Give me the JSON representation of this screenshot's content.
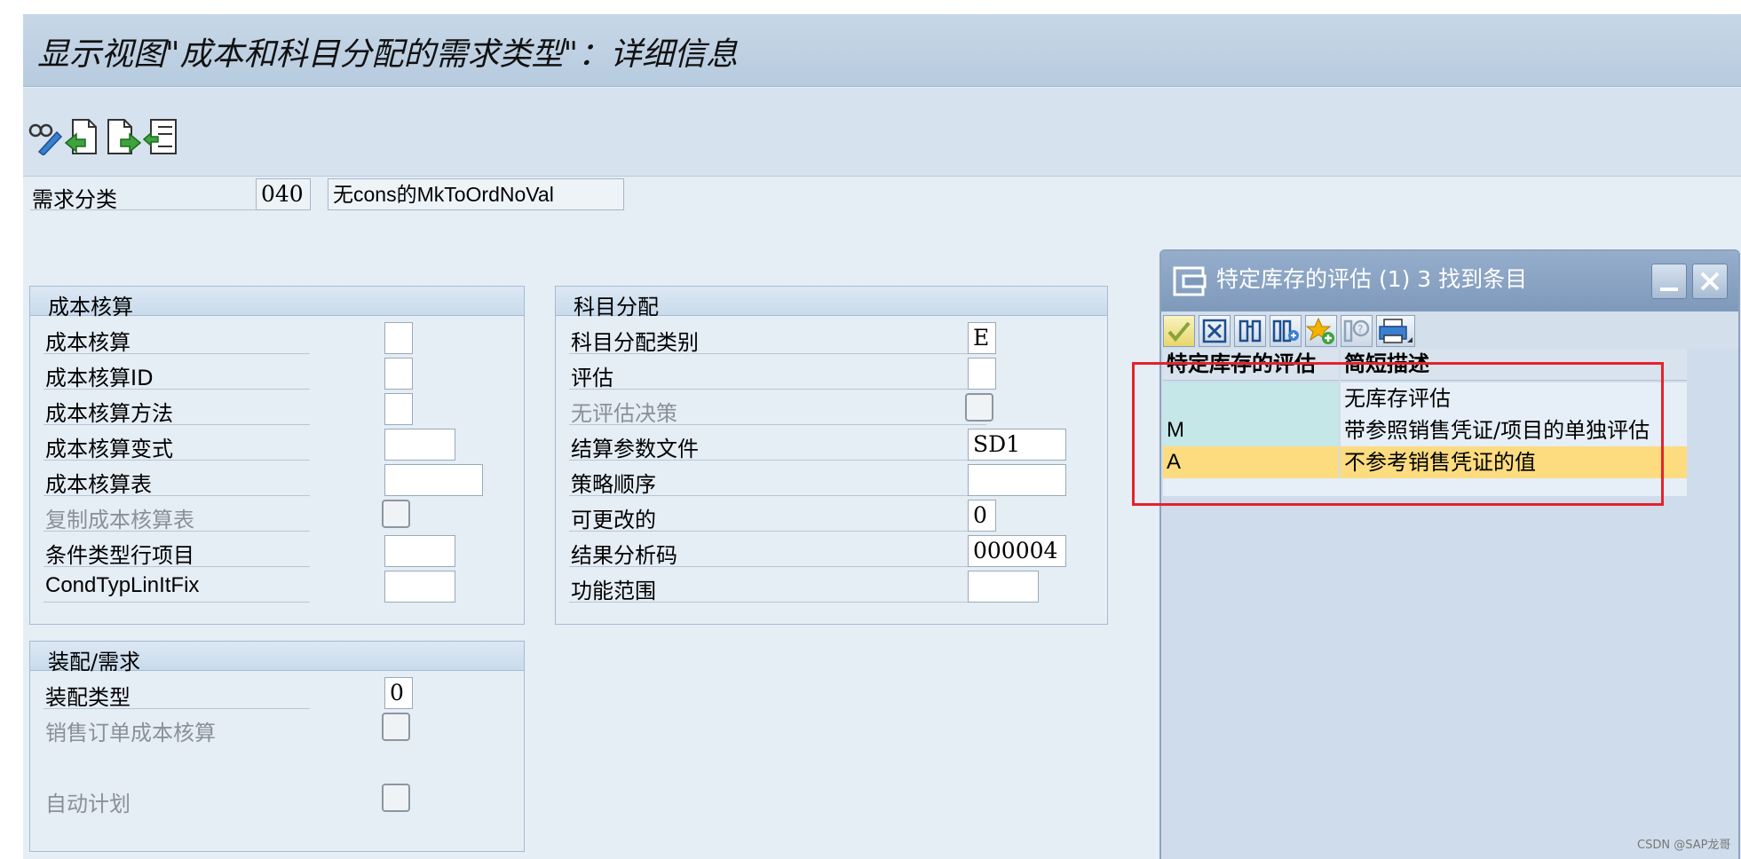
{
  "window": {
    "title": "显示视图\"成本和科目分配的需求类型\"：详细信息"
  },
  "toolbar": {
    "icons": [
      "display-change-icon",
      "previous-entry-icon",
      "next-entry-icon",
      "select-block-icon"
    ]
  },
  "header": {
    "req_class_label": "需求分类",
    "req_class_value": "040",
    "req_class_desc": "无cons的MkToOrdNoVal"
  },
  "costing_group": {
    "title": "成本核算",
    "rows": [
      {
        "label": "成本核算",
        "value": "",
        "disabled": false
      },
      {
        "label": "成本核算ID",
        "value": "",
        "disabled": false
      },
      {
        "label": "成本核算方法",
        "value": "",
        "disabled": false
      },
      {
        "label": "成本核算变式",
        "value": "",
        "disabled": false
      },
      {
        "label": "成本核算表",
        "value": "",
        "disabled": false
      },
      {
        "label": "复制成本核算表",
        "value": "",
        "disabled": true
      },
      {
        "label": "条件类型行项目",
        "value": "",
        "disabled": false
      },
      {
        "label": "CondTypLinItFix",
        "value": "",
        "disabled": false
      }
    ]
  },
  "assembly_group": {
    "title": "装配/需求",
    "rows": [
      {
        "label": "装配类型",
        "value": "0",
        "disabled": false
      },
      {
        "label": "销售订单成本核算",
        "value": "",
        "disabled": true
      },
      {
        "label": "自动计划",
        "value": "",
        "disabled": true
      }
    ]
  },
  "acct_group": {
    "title": "科目分配",
    "rows": [
      {
        "label": "科目分配类别",
        "value": "E",
        "disabled": false
      },
      {
        "label": "评估",
        "value": "",
        "disabled": false
      },
      {
        "label": "无评估决策",
        "value": "",
        "disabled": true
      },
      {
        "label": "结算参数文件",
        "value": "SD1",
        "disabled": false
      },
      {
        "label": "策略顺序",
        "value": "",
        "disabled": false
      },
      {
        "label": "可更改的",
        "value": "0",
        "disabled": false
      },
      {
        "label": "结果分析码",
        "value": "000004",
        "disabled": false
      },
      {
        "label": "功能范围",
        "value": "",
        "disabled": false
      }
    ]
  },
  "dialog": {
    "title": "特定库存的评估 (1)    3 找到条目",
    "toolbar_icons": [
      "confirm-check-icon",
      "cancel-icon",
      "find-icon",
      "find-next-icon",
      "favorites-icon",
      "help-icon",
      "print-icon"
    ],
    "columns": [
      "特定库存的评估",
      "简短描述"
    ],
    "rows": [
      {
        "key": "",
        "desc": "无库存评估"
      },
      {
        "key": "M",
        "desc": "带参照销售凭证/项目的单独评估"
      },
      {
        "key": "A",
        "desc": "不参考销售凭证的值"
      }
    ],
    "selected_row": 2,
    "colors": {
      "key_bg": "#c5e7e8",
      "selected_bg": "#fddc7f",
      "highlight_border": "#e4222b"
    }
  },
  "watermark": "CSDN @SAP龙哥"
}
